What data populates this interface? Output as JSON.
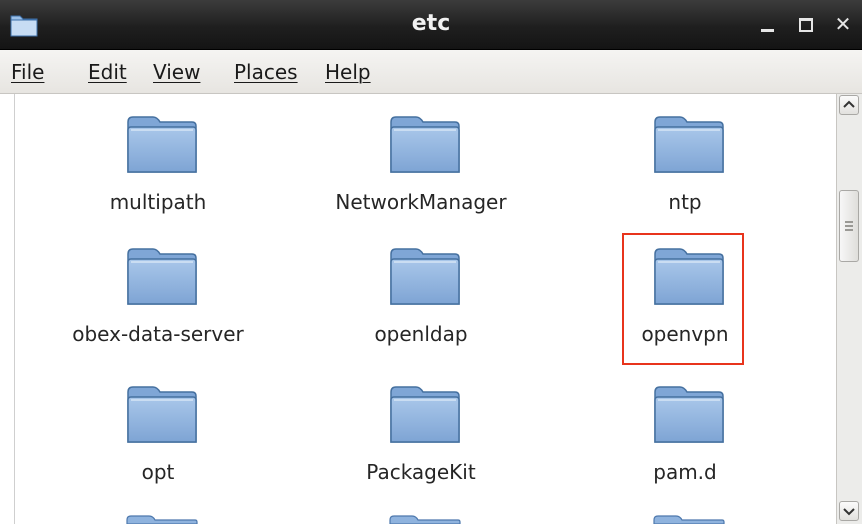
{
  "window": {
    "title": "etc",
    "controls": {
      "minimize": "minimize",
      "maximize": "maximize",
      "close": "✕"
    }
  },
  "menu": [
    {
      "label": "File"
    },
    {
      "label": "Edit"
    },
    {
      "label": "View"
    },
    {
      "label": "Places"
    },
    {
      "label": "Help"
    }
  ],
  "folders": [
    {
      "name": "multipath"
    },
    {
      "name": "NetworkManager"
    },
    {
      "name": "ntp"
    },
    {
      "name": "obex-data-server"
    },
    {
      "name": "openldap"
    },
    {
      "name": "openvpn",
      "highlighted": true
    },
    {
      "name": "opt"
    },
    {
      "name": "PackageKit"
    },
    {
      "name": "pam.d"
    }
  ],
  "colors": {
    "folder": "#8fb3de",
    "highlight": "#e8341c",
    "titlebar": "#1f1f1f"
  },
  "icons": {
    "folder": "folder-icon",
    "app": "folder-app-icon"
  }
}
